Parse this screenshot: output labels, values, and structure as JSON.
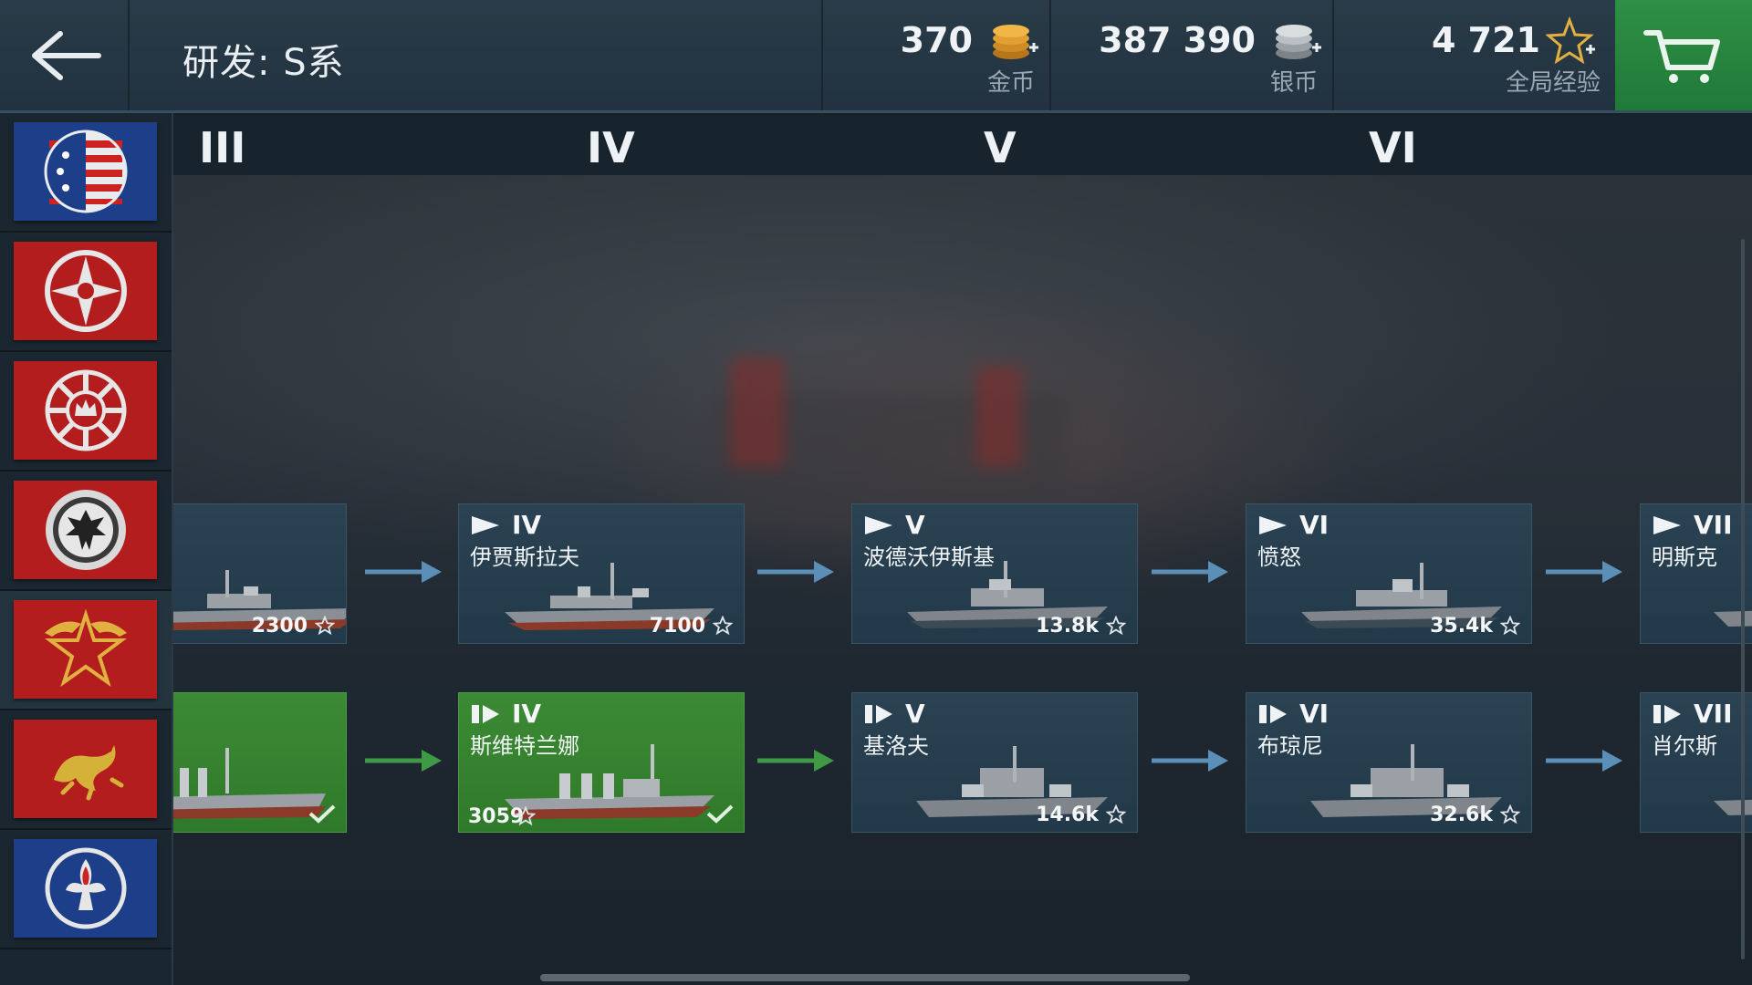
{
  "header": {
    "title": "研发: S系",
    "currencies": [
      {
        "value": "370",
        "label": "金币",
        "icon": "gold-coins-icon"
      },
      {
        "value": "387 390",
        "label": "银币",
        "icon": "silver-coins-icon"
      },
      {
        "value": "4 721",
        "label": "全局经验",
        "icon": "free-xp-star-icon"
      }
    ]
  },
  "nations": [
    {
      "name": "usa-flag-icon",
      "color": "#1d3f8a"
    },
    {
      "name": "japan-flag-icon",
      "color": "#b31d1d"
    },
    {
      "name": "uk-flag-icon",
      "color": "#b31d1d"
    },
    {
      "name": "germany-flag-icon",
      "color": "#b31d1d"
    },
    {
      "name": "ussr-flag-icon",
      "color": "#b31d1d",
      "selected": true
    },
    {
      "name": "china-flag-icon",
      "color": "#b31d1d"
    },
    {
      "name": "france-flag-icon",
      "color": "#1d3f8a"
    }
  ],
  "tiers": [
    "III",
    "IV",
    "V",
    "VI"
  ],
  "tree": {
    "row1": [
      {
        "tier": "",
        "name": "",
        "cost": "2300"
      },
      {
        "tier": "IV",
        "name": "伊贾斯拉夫",
        "cost": "7100"
      },
      {
        "tier": "V",
        "name": "波德沃伊斯基",
        "cost": "13.8k"
      },
      {
        "tier": "VI",
        "name": "愤怒",
        "cost": "35.4k"
      },
      {
        "tier": "VII",
        "name": "明斯克",
        "cost": ""
      }
    ],
    "row2": [
      {
        "tier": "",
        "name": "",
        "cost": "",
        "owned": true
      },
      {
        "tier": "IV",
        "name": "斯维特兰娜",
        "cost": "3059",
        "owned": true
      },
      {
        "tier": "V",
        "name": "基洛夫",
        "cost": "14.6k"
      },
      {
        "tier": "VI",
        "name": "布琼尼",
        "cost": "32.6k"
      },
      {
        "tier": "VII",
        "name": "肖尔斯",
        "cost": ""
      }
    ]
  },
  "colors": {
    "accent_green": "#2f8f45",
    "card_blue": "#2a4252",
    "card_owned": "#3c8a35",
    "arrow_blue": "#5b8fb8",
    "arrow_green": "#3f9a45"
  }
}
